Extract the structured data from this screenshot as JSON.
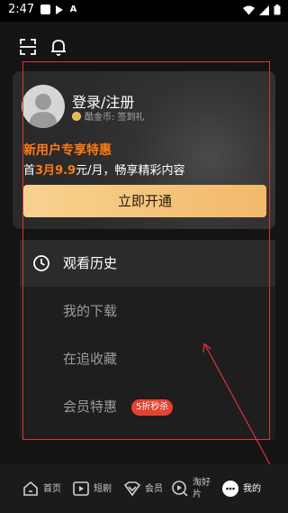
{
  "status_bar": {
    "time": "2:47"
  },
  "top_bar": {
    "scan_icon": "scan-icon",
    "bell_icon": "bell-icon"
  },
  "user_card": {
    "login_title": "登录/注册",
    "coin_text": "酷金币: 签到礼",
    "promo_title": "新用户专享特惠",
    "promo_prefix": "首",
    "promo_months": "3月",
    "promo_price": "9.9",
    "promo_suffix": "元/月，畅享精彩内容",
    "open_button": "立即开通"
  },
  "menu": {
    "items": [
      {
        "label": "观看历史",
        "icon": "clock-icon"
      },
      {
        "label": "我的下载"
      },
      {
        "label": "在追收藏"
      },
      {
        "label": "会员特惠",
        "badge": "5折秒杀"
      }
    ]
  },
  "bottom_nav": {
    "items": [
      {
        "label": "首页",
        "icon": "home-icon"
      },
      {
        "label": "短剧",
        "icon": "play-icon"
      },
      {
        "label": "会员",
        "icon": "vip-icon"
      },
      {
        "label_line1": "淘好",
        "label_line2": "片",
        "icon": "discover-icon"
      },
      {
        "label": "我的",
        "icon": "profile-icon"
      }
    ]
  },
  "colors": {
    "accent": "#ff7b0f",
    "button_gold": "#f2b96a",
    "badge_red": "#e8412c",
    "annotation_red": "#e0303a"
  }
}
